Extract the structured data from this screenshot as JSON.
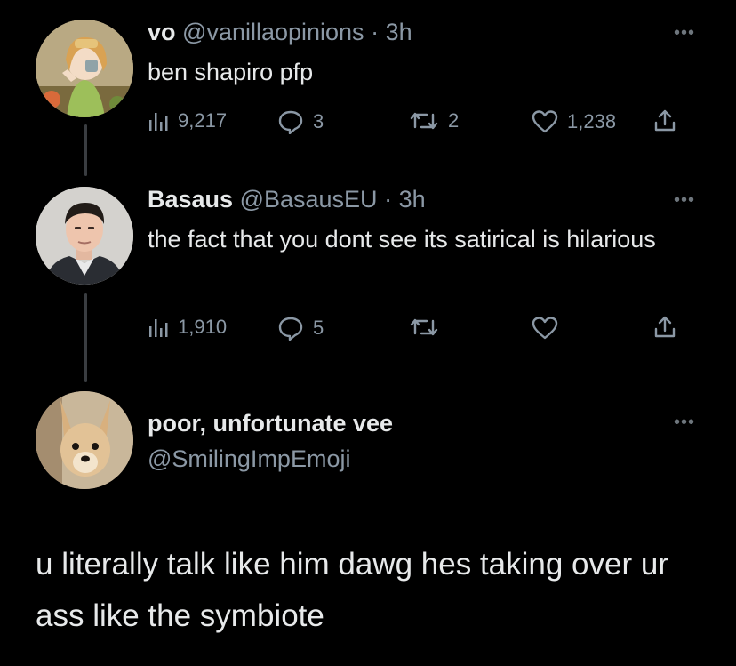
{
  "tweets": [
    {
      "name": "vo",
      "handle": "@vanillaopinions",
      "time": "3h",
      "text": "ben shapiro pfp",
      "views": "9,217",
      "replies": "3",
      "retweets": "2",
      "likes": "1,238",
      "avatar": "anime-girl-avatar"
    },
    {
      "name": "Basaus",
      "handle": "@BasausEU",
      "time": "3h",
      "text": "the fact that you dont see its satirical is hilarious",
      "views": "1,910",
      "replies": "5",
      "retweets": "",
      "likes": "",
      "avatar": "man-portrait-avatar"
    }
  ],
  "focused": {
    "name": "poor, unfortunate vee",
    "handle": "@SmilingImpEmoji",
    "text": "u literally talk like him dawg hes taking over ur ass like the symbiote",
    "avatar": "dog-photo-avatar"
  },
  "icons": {
    "views": "bar-chart-icon",
    "replies": "speech-bubble-icon",
    "retweets": "retweet-icon",
    "likes": "heart-icon",
    "share": "share-icon",
    "more": "more-dots-icon"
  }
}
